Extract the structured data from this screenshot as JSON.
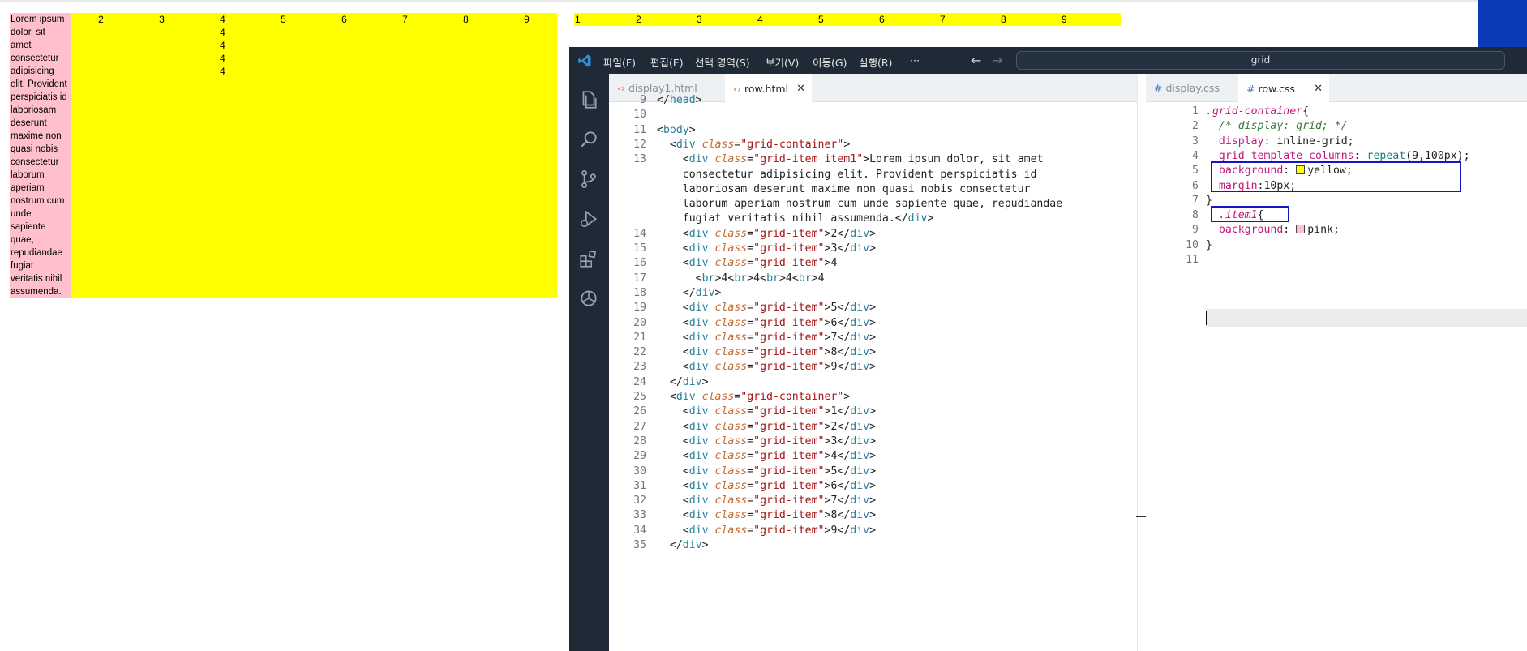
{
  "preview": {
    "grid1": {
      "item1_lines": [
        "Lorem ipsum",
        "dolor, sit",
        "amet",
        "consectetur",
        "adipisicing",
        "elit. Provident",
        "perspiciatis id",
        "laboriosam",
        "deserunt",
        "maxime non",
        "quasi nobis",
        "consectetur",
        "laborum",
        "aperiam",
        "nostrum cum",
        "unde",
        "sapiente",
        "quae,",
        "repudiandae",
        "fugiat",
        "veritatis nihil",
        "assumenda."
      ],
      "items": [
        "2",
        "3",
        "4",
        "5",
        "6",
        "7",
        "8",
        "9"
      ],
      "item4_lines": [
        "4",
        "4",
        "4",
        "4",
        "4"
      ]
    },
    "grid2": {
      "items": [
        "1",
        "2",
        "3",
        "4",
        "5",
        "6",
        "7",
        "8",
        "9"
      ]
    }
  },
  "vscode": {
    "menus": [
      "파일(F)",
      "편집(E)",
      "선택 영역(S)",
      "보기(V)",
      "이동(G)",
      "실행(R)",
      "···"
    ],
    "command_center": "grid",
    "left_tabs": [
      {
        "label": "display1.html",
        "icon": "‹›"
      },
      {
        "label": "row.html",
        "icon": "‹›",
        "close": "✕"
      }
    ],
    "right_tabs": [
      {
        "label": "display.css",
        "icon": "#"
      },
      {
        "label": "row.css",
        "icon": "#",
        "close": "✕"
      }
    ],
    "html_lines": [
      {
        "n": "9",
        "text": "</head>"
      },
      {
        "n": "10",
        "text": ""
      },
      {
        "n": "11",
        "text": "<body>"
      },
      {
        "n": "12",
        "text": "  <div class=\"grid-container\">"
      },
      {
        "n": "13",
        "text": "    <div class=\"grid-item item1\">Lorem ipsum dolor, sit amet"
      },
      {
        "n": "",
        "text": "    consectetur adipisicing elit. Provident perspiciatis id"
      },
      {
        "n": "",
        "text": "    laboriosam deserunt maxime non quasi nobis consectetur"
      },
      {
        "n": "",
        "text": "    laborum aperiam nostrum cum unde sapiente quae, repudiandae"
      },
      {
        "n": "",
        "text": "    fugiat veritatis nihil assumenda.</div>"
      },
      {
        "n": "14",
        "text": "    <div class=\"grid-item\">2</div>"
      },
      {
        "n": "15",
        "text": "    <div class=\"grid-item\">3</div>"
      },
      {
        "n": "16",
        "text": "    <div class=\"grid-item\">4"
      },
      {
        "n": "17",
        "text": "      <br>4<br>4<br>4<br>4"
      },
      {
        "n": "18",
        "text": "    </div>"
      },
      {
        "n": "19",
        "text": "    <div class=\"grid-item\">5</div>"
      },
      {
        "n": "20",
        "text": "    <div class=\"grid-item\">6</div>"
      },
      {
        "n": "21",
        "text": "    <div class=\"grid-item\">7</div>"
      },
      {
        "n": "22",
        "text": "    <div class=\"grid-item\">8</div>"
      },
      {
        "n": "23",
        "text": "    <div class=\"grid-item\">9</div>"
      },
      {
        "n": "24",
        "text": "  </div>"
      },
      {
        "n": "25",
        "text": "  <div class=\"grid-container\">"
      },
      {
        "n": "26",
        "text": "    <div class=\"grid-item\">1</div>"
      },
      {
        "n": "27",
        "text": "    <div class=\"grid-item\">2</div>"
      },
      {
        "n": "28",
        "text": "    <div class=\"grid-item\">3</div>"
      },
      {
        "n": "29",
        "text": "    <div class=\"grid-item\">4</div>"
      },
      {
        "n": "30",
        "text": "    <div class=\"grid-item\">5</div>"
      },
      {
        "n": "31",
        "text": "    <div class=\"grid-item\">6</div>"
      },
      {
        "n": "32",
        "text": "    <div class=\"grid-item\">7</div>"
      },
      {
        "n": "33",
        "text": "    <div class=\"grid-item\">8</div>"
      },
      {
        "n": "34",
        "text": "    <div class=\"grid-item\">9</div>"
      },
      {
        "n": "35",
        "text": "  </div>"
      }
    ],
    "css_lines": [
      {
        "n": "1",
        "text": ".grid-container{"
      },
      {
        "n": "2",
        "text": "  /* display: grid; */"
      },
      {
        "n": "3",
        "text": "  display: inline-grid;"
      },
      {
        "n": "4",
        "text": "  grid-template-columns: repeat(9,100px);"
      },
      {
        "n": "5",
        "text": "  background: yellow;"
      },
      {
        "n": "6",
        "text": "  margin:10px;"
      },
      {
        "n": "7",
        "text": "}"
      },
      {
        "n": "8",
        "text": "  .item1{"
      },
      {
        "n": "9",
        "text": "  background: pink;"
      },
      {
        "n": "10",
        "text": "}"
      },
      {
        "n": "11",
        "text": ""
      }
    ],
    "colors": {
      "swatch_yellow": "#ffff00",
      "swatch_pink": "#ffc0cb",
      "highlight": "#1414c8"
    }
  }
}
